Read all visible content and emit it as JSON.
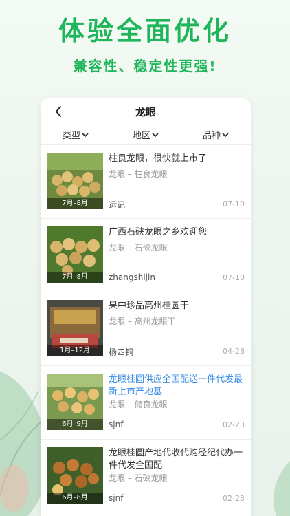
{
  "promo": {
    "title": "体验全面优化",
    "subtitle": "兼容性、稳定性更强!"
  },
  "nav": {
    "title": "龙眼"
  },
  "filters": [
    {
      "label": "类型"
    },
    {
      "label": "地区"
    },
    {
      "label": "品种"
    }
  ],
  "items": [
    {
      "title": "柱良龙眼，很快就上市了",
      "category": "龙眼 – 柱良龙眼",
      "user": "运记",
      "date": "07-10",
      "season": "7月–8月",
      "highlight": false
    },
    {
      "title": "广西石硖龙眼之乡欢迎您",
      "category": "龙眼 – 石硖龙眼",
      "user": "zhangshijin",
      "date": "07-10",
      "season": "7月–8月",
      "highlight": false
    },
    {
      "title": "果中珍品高州桂圆干",
      "category": "龙眼 – 高州龙眼干",
      "user": "杨四铜",
      "date": "04-28",
      "season": "1月–12月",
      "highlight": false
    },
    {
      "title": "龙眼桂圆供应全国配送一件代发最新上市产地基",
      "category": "龙眼 – 储良龙眼",
      "user": "sjnf",
      "date": "02-23",
      "season": "6月–9月",
      "highlight": true
    },
    {
      "title": "龙眼桂圆产地代收代购经纪代办一件代发全国配",
      "category": "龙眼 – 石硖龙眼",
      "user": "sjnf",
      "date": "02-23",
      "season": "6月–8月",
      "highlight": false
    }
  ],
  "colors": {
    "accent": "#1fb55a",
    "link": "#3a8ee6"
  }
}
